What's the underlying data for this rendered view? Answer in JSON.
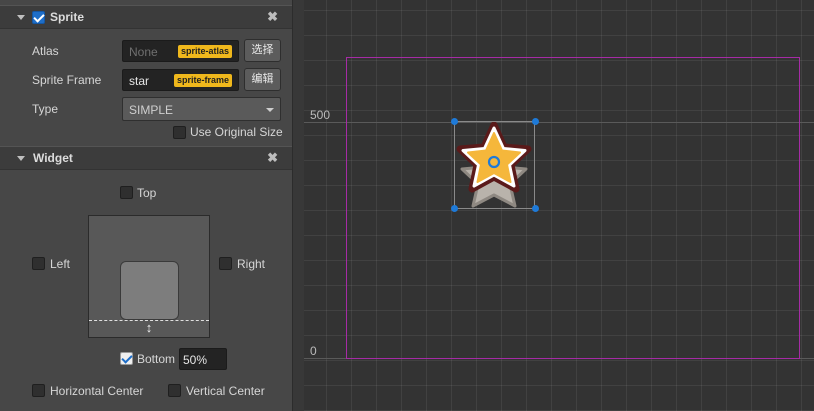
{
  "sprite": {
    "title": "Sprite",
    "enabled": true,
    "close_icon": "close-icon",
    "atlas_label": "Atlas",
    "atlas_value": "None",
    "atlas_tag": "sprite-atlas",
    "atlas_button": "选择",
    "frame_label": "Sprite Frame",
    "frame_value": "star",
    "frame_tag": "sprite-frame",
    "frame_button": "编辑",
    "type_label": "Type",
    "type_value": "SIMPLE",
    "use_original_size_label": "Use Original Size",
    "use_original_size": false
  },
  "widget": {
    "title": "Widget",
    "close_icon": "close-icon",
    "top_label": "Top",
    "left_label": "Left",
    "right_label": "Right",
    "bottom_label": "Bottom",
    "bottom_checked": true,
    "bottom_value": "50%",
    "horizontal_center_label": "Horizontal Center",
    "vertical_center_label": "Vertical Center"
  },
  "scene": {
    "axis_label_top": "500",
    "axis_label_bottom": "0",
    "canvas_border_color": "#a62ba6",
    "handle_color": "#1e7ad8",
    "star_fill": "#f5b73b",
    "star_outline": "#5a1a1a"
  }
}
